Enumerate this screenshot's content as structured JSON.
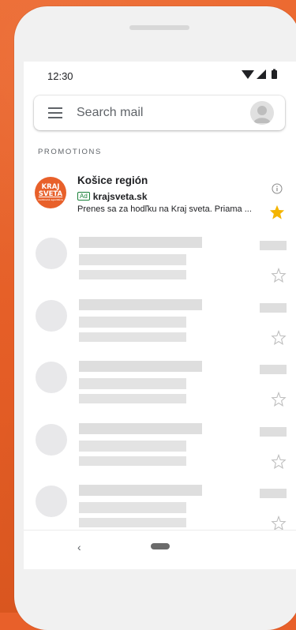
{
  "status_bar": {
    "time": "12:30"
  },
  "search": {
    "placeholder": "Search mail"
  },
  "section": {
    "label": "PROMOTIONS"
  },
  "promo": {
    "logo_line1": "KRAJ",
    "logo_line2": "SVETA",
    "logo_line3": "cestovná agentúra",
    "title": "Košice región",
    "ad_badge": "Ad",
    "domain": "krajsveta.sk",
    "snippet": "Prenes sa za hodľku na Kraj sveta. Priama ...",
    "starred": true
  },
  "placeholder_rows": 5,
  "colors": {
    "background": "#e8602a",
    "star": "#f4b400",
    "ad_green": "#188038"
  },
  "icons": {
    "menu": "menu-icon",
    "avatar": "account-icon",
    "info": "info-icon",
    "star": "star-icon",
    "back": "back-icon",
    "home": "home-pill-icon"
  }
}
